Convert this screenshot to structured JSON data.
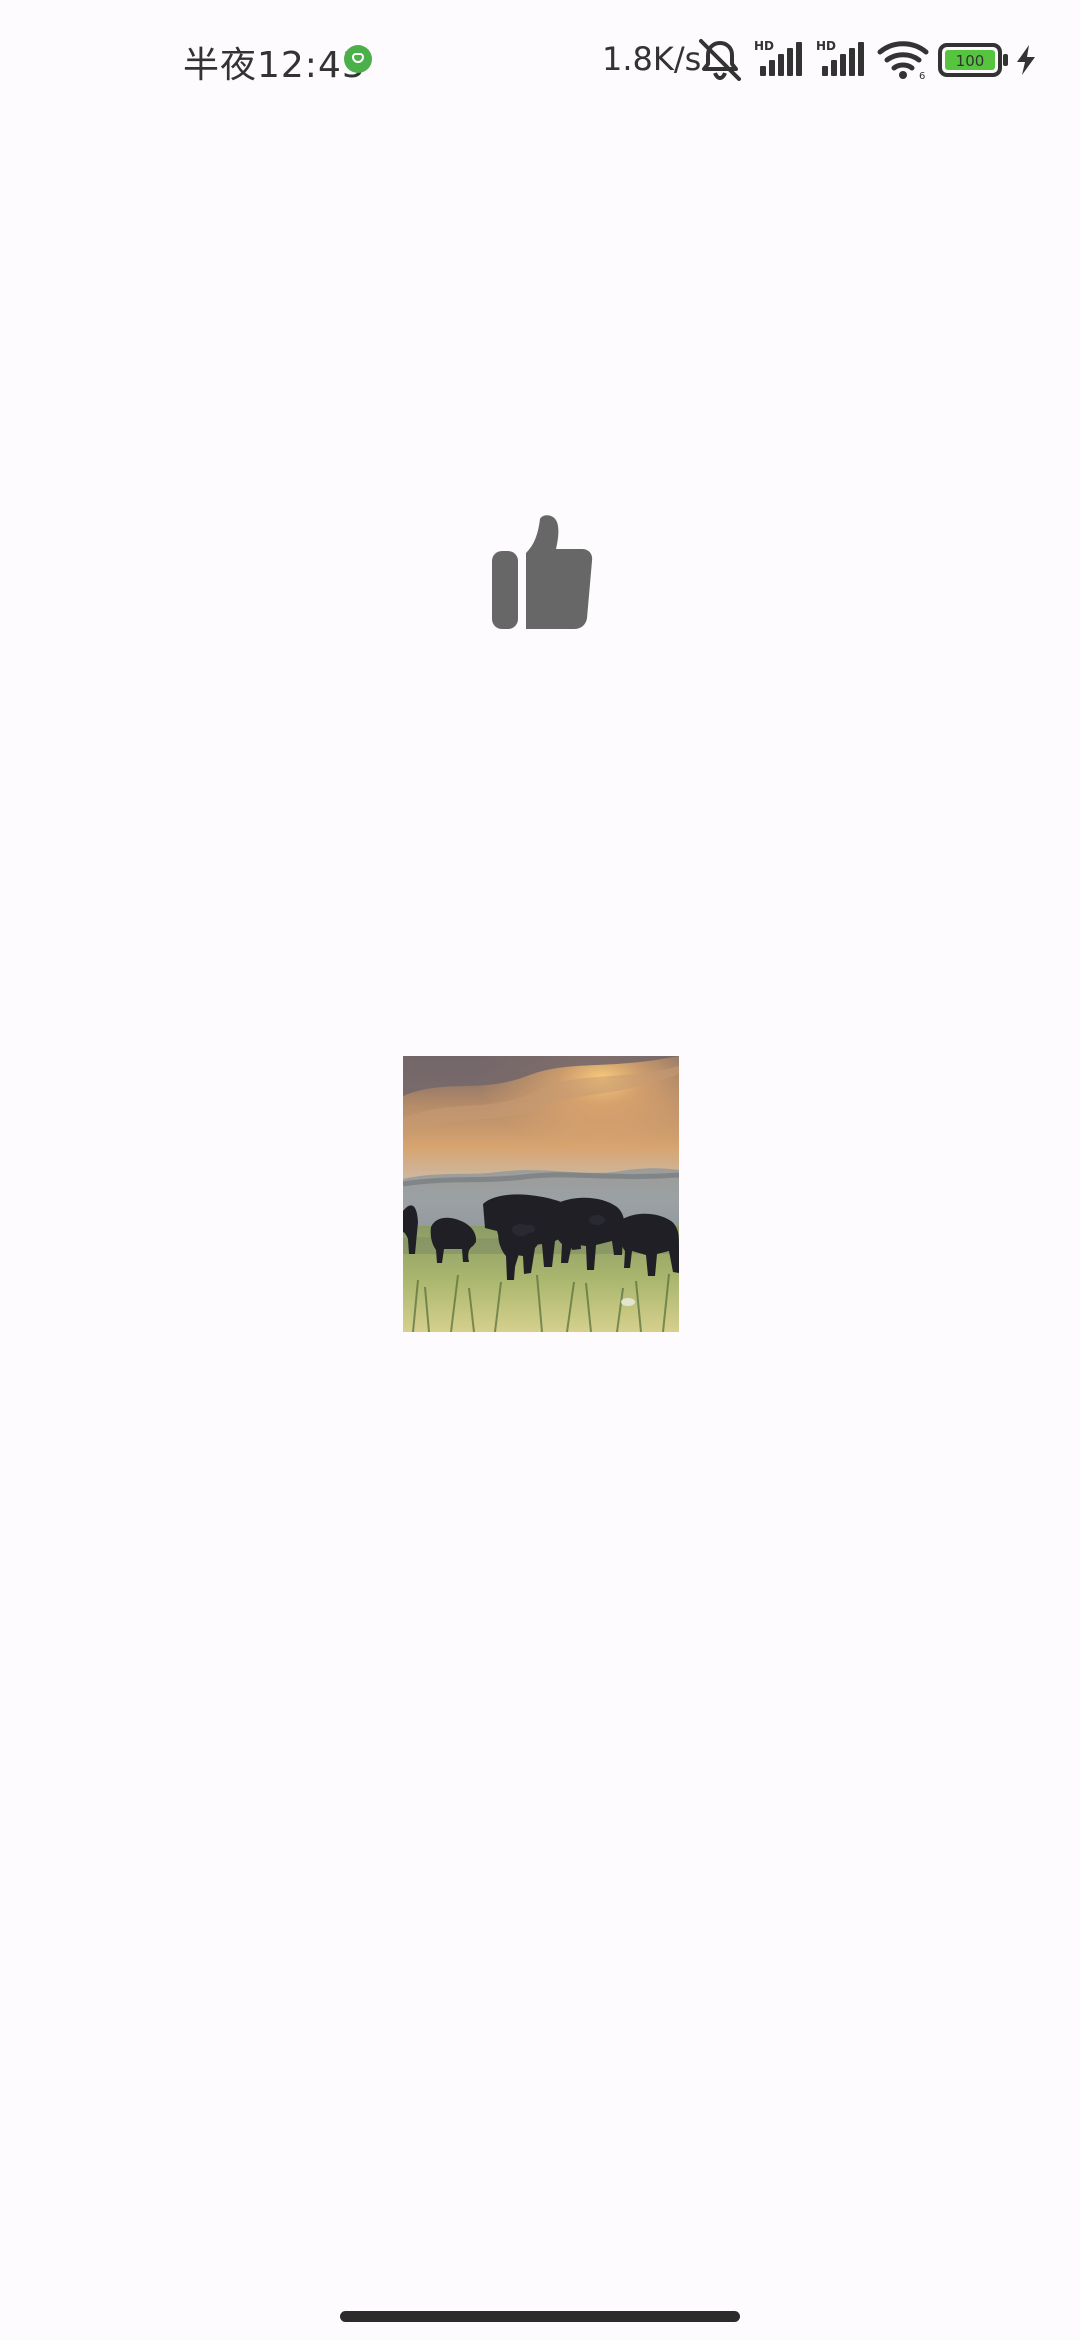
{
  "status_bar": {
    "time": "半夜12:43",
    "network_speed": "1.8K/s",
    "signal_1_label": "HD",
    "signal_2_label": "HD",
    "wifi_label": "6",
    "battery_level": "100"
  },
  "content": {
    "center_icon": "thumbs-up-icon",
    "image_description_icon": "water-buffalo-photo"
  },
  "colors": {
    "background": "#fdfbfd",
    "status_text": "#333333",
    "app_dot": "#4cb04a",
    "battery_fill": "#57c43f",
    "thumbs_up": "#676767",
    "home_indicator": "#2b2b2b"
  }
}
